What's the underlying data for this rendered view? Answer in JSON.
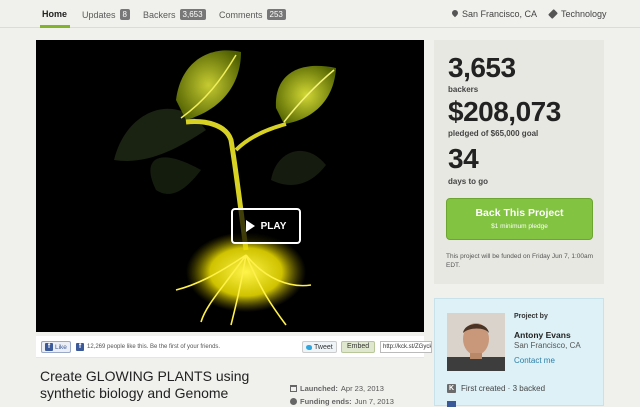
{
  "nav": {
    "tabs": [
      {
        "label": "Home",
        "count": null
      },
      {
        "label": "Updates",
        "count": "8"
      },
      {
        "label": "Backers",
        "count": "3,653"
      },
      {
        "label": "Comments",
        "count": "253"
      }
    ],
    "location": "San Francisco, CA",
    "category": "Technology"
  },
  "video": {
    "play_label": "PLAY"
  },
  "social": {
    "like_label": "Like",
    "like_text": "12,269 people like this. Be the first of your friends.",
    "tweet_label": "Tweet",
    "embed_label": "Embed",
    "short_url": "http://kck.st/ZGyckx"
  },
  "project": {
    "title": "Create GLOWING PLANTS using synthetic biology and Genome",
    "launched_label": "Launched:",
    "launched_value": "Apr 23, 2013",
    "funding_label": "Funding ends:",
    "funding_value": "Jun 7, 2013"
  },
  "stats": {
    "backers_value": "3,653",
    "backers_label": "backers",
    "pledged_value": "$208,073",
    "pledged_label": "pledged of $65,000 goal",
    "days_value": "34",
    "days_label": "days to go",
    "back_button": "Back This Project",
    "back_sub": "$1 minimum pledge",
    "funded_note": "This project will be funded on Friday Jun 7, 1:00am EDT."
  },
  "creator": {
    "heading": "Project by",
    "name": "Antony Evans",
    "location": "San Francisco, CA",
    "contact_label": "Contact me",
    "history": "First created · 3 backed"
  },
  "colors": {
    "accent_green": "#82c341",
    "creator_panel": "#ddf1f7",
    "stats_panel": "#e8e8e2",
    "glow_yellow": "#e6e200"
  }
}
